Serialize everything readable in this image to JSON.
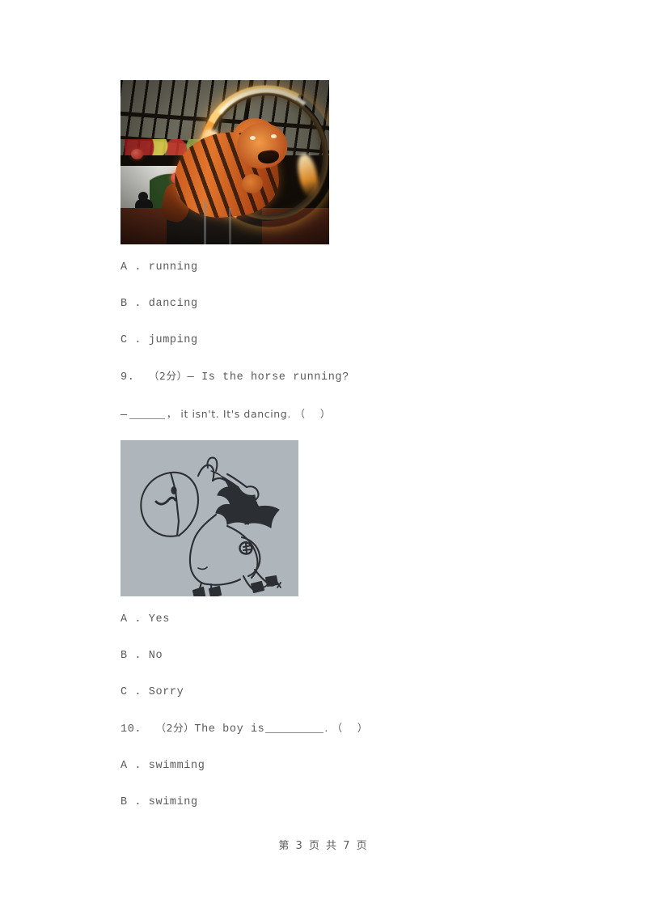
{
  "document": {
    "type": "exam-worksheet-page",
    "page_background": "#ffffff",
    "text_color": "#5a5a5a"
  },
  "figures": {
    "tiger": {
      "alt": "Photo of a tiger leaping through a flaming hoop at a circus",
      "caption": ""
    },
    "horse": {
      "alt": "Hand-drawn pen sketch of a horse on gray paper",
      "caption": "",
      "background_color": "#aeb6bb"
    }
  },
  "questions": [
    {
      "id": "q8-options",
      "options": [
        "A . running",
        "B . dancing",
        "C . jumping"
      ]
    },
    {
      "id": "q9",
      "number": "9.",
      "score": "（2分）",
      "stem_line_1": "— Is the horse running?",
      "stem_line_2_pre": "—",
      "stem_line_2_post": "， it isn't. It's dancing. （    ）",
      "options": [
        "A . Yes",
        "B . No",
        "C . Sorry"
      ]
    },
    {
      "id": "q10",
      "number": "10.",
      "score": "（2分）",
      "stem_pre": "The boy is",
      "stem_post": ". （    ）",
      "options": [
        "A . swimming",
        "B . swiming"
      ]
    }
  ],
  "footer": {
    "text": "第 3 页 共 7 页"
  }
}
